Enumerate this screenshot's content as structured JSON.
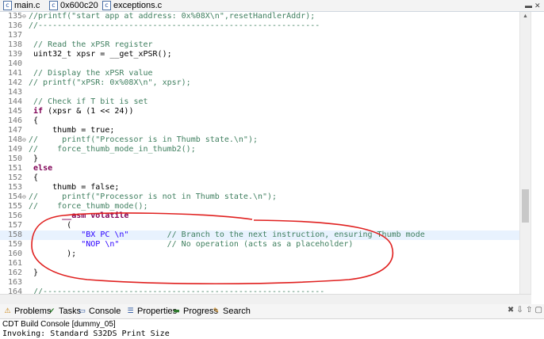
{
  "tabs": [
    {
      "label": "main.c",
      "icon": "c-file-icon"
    },
    {
      "label": "0x600c20",
      "icon": "c-file-icon"
    },
    {
      "label": "exceptions.c",
      "icon": "c-file-icon"
    }
  ],
  "window_controls": {
    "close": "✕",
    "minimize": "▬"
  },
  "editor": {
    "lines": [
      {
        "num": "135",
        "fold": "⊖",
        "segments": [
          {
            "t": "//printf(\"start app at address: 0x%08X\\n\",resetHandlerAddr);",
            "c": "cm"
          }
        ]
      },
      {
        "num": "136",
        "segments": [
          {
            "t": "//-----------------------------------------------------------",
            "c": "cm"
          }
        ]
      },
      {
        "num": "137",
        "segments": []
      },
      {
        "num": "138",
        "segments": [
          {
            "t": " // Read the xPSR register",
            "c": "cm"
          }
        ]
      },
      {
        "num": "139",
        "segments": [
          {
            "t": " uint32_t xpsr = __get_xPSR();",
            "c": ""
          }
        ]
      },
      {
        "num": "140",
        "segments": []
      },
      {
        "num": "141",
        "segments": [
          {
            "t": " // Display the xPSR value",
            "c": "cm"
          }
        ]
      },
      {
        "num": "142",
        "segments": [
          {
            "t": "// printf(\"xPSR: 0x%08X\\n\", xpsr);",
            "c": "cm"
          }
        ]
      },
      {
        "num": "143",
        "segments": []
      },
      {
        "num": "144",
        "segments": [
          {
            "t": " // Check if T bit is set",
            "c": "cm"
          }
        ]
      },
      {
        "num": "145",
        "segments": [
          {
            "t": " ",
            "c": ""
          },
          {
            "t": "if",
            "c": "kw"
          },
          {
            "t": " (xpsr & (1 << 24))",
            "c": ""
          }
        ]
      },
      {
        "num": "146",
        "segments": [
          {
            "t": " {",
            "c": ""
          }
        ]
      },
      {
        "num": "147",
        "segments": [
          {
            "t": "     thumb = true;",
            "c": ""
          }
        ]
      },
      {
        "num": "148",
        "fold": "⊖",
        "segments": [
          {
            "t": "//     printf(\"Processor is in Thumb state.\\n\");",
            "c": "cm"
          }
        ]
      },
      {
        "num": "149",
        "segments": [
          {
            "t": "//    force_thumb_mode_in_thumb2();",
            "c": "cm"
          }
        ]
      },
      {
        "num": "150",
        "segments": [
          {
            "t": " }",
            "c": ""
          }
        ]
      },
      {
        "num": "151",
        "segments": [
          {
            "t": " ",
            "c": ""
          },
          {
            "t": "else",
            "c": "kw"
          }
        ]
      },
      {
        "num": "152",
        "segments": [
          {
            "t": " {",
            "c": ""
          }
        ]
      },
      {
        "num": "153",
        "segments": [
          {
            "t": "     thumb = false;",
            "c": ""
          }
        ]
      },
      {
        "num": "154",
        "fold": "⊖",
        "segments": [
          {
            "t": "//     printf(\"Processor is not in Thumb state.\\n\");",
            "c": "cm"
          }
        ]
      },
      {
        "num": "155",
        "segments": [
          {
            "t": "//    force_thumb_mode();",
            "c": "cm"
          }
        ]
      },
      {
        "num": "156",
        "segments": [
          {
            "t": "       ",
            "c": ""
          },
          {
            "t": "__asm volatile",
            "c": "kw"
          }
        ]
      },
      {
        "num": "157",
        "segments": [
          {
            "t": "        (",
            "c": ""
          }
        ]
      },
      {
        "num": "158",
        "hl": true,
        "segments": [
          {
            "t": "           ",
            "c": ""
          },
          {
            "t": "\"BX PC \\n\"",
            "c": "st"
          },
          {
            "t": "        ",
            "c": ""
          },
          {
            "t": "// Branch to the next instruction, ensuring Thumb mode",
            "c": "cm"
          }
        ]
      },
      {
        "num": "159",
        "segments": [
          {
            "t": "           ",
            "c": ""
          },
          {
            "t": "\"NOP \\n\"",
            "c": "st"
          },
          {
            "t": "          ",
            "c": ""
          },
          {
            "t": "// No operation (acts as a placeholder)",
            "c": "cm"
          }
        ]
      },
      {
        "num": "160",
        "segments": [
          {
            "t": "        );",
            "c": ""
          }
        ]
      },
      {
        "num": "161",
        "segments": []
      },
      {
        "num": "162",
        "segments": [
          {
            "t": " }",
            "c": ""
          }
        ]
      },
      {
        "num": "163",
        "segments": []
      },
      {
        "num": "164",
        "segments": [
          {
            "t": " //-----------------------------------------------------------",
            "c": "cm"
          }
        ]
      }
    ]
  },
  "panel": {
    "tabs": [
      {
        "label": "Problems",
        "icon": "problems-icon",
        "glyph": "⚠",
        "color": "#c47a00"
      },
      {
        "label": "Tasks",
        "icon": "tasks-icon",
        "glyph": "✔",
        "color": "#2d7a2d"
      },
      {
        "label": "Console",
        "icon": "console-icon",
        "glyph": "▭",
        "color": "#1f4e9c"
      },
      {
        "label": "Properties",
        "icon": "properties-icon",
        "glyph": "☰",
        "color": "#1f4e9c"
      },
      {
        "label": "Progress",
        "icon": "progress-icon",
        "glyph": "▬",
        "color": "#2d7a2d"
      },
      {
        "label": "Search",
        "icon": "search-icon",
        "glyph": "✎",
        "color": "#c47a00"
      }
    ],
    "console_title": "CDT Build Console [dummy_05]",
    "console_output": "Invoking: Standard S32DS Print Size"
  },
  "annotation": {
    "color": "#e0201f"
  }
}
